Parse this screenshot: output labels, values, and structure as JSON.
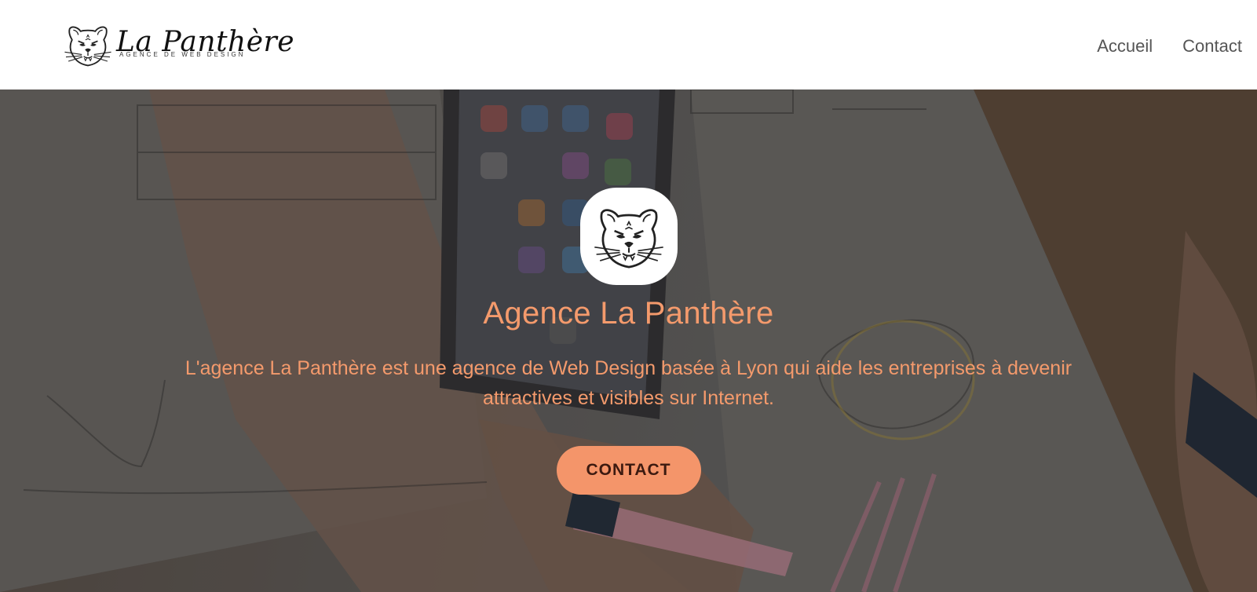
{
  "header": {
    "brand_name": "La Panthère",
    "brand_tagline": "AGENCE DE WEB DESIGN",
    "logo_icon": "panther-head-icon",
    "nav": [
      {
        "label": "Accueil"
      },
      {
        "label": "Contact"
      }
    ]
  },
  "hero": {
    "badge_icon": "panther-head-icon",
    "title": "Agence La Panthère",
    "description": "L'agence La Panthère est une agence de Web Design basée à Lyon qui aide les entreprises à devenir attractives et visibles sur Internet.",
    "cta_label": "CONTACT",
    "background": "desk-with-phone-and-wireframe-sketches-photo"
  },
  "colors": {
    "accent": "#f49a6c",
    "button_bg": "#f4956a",
    "button_text": "#3c1a10",
    "header_bg": "#ffffff",
    "nav_text": "#555555"
  }
}
